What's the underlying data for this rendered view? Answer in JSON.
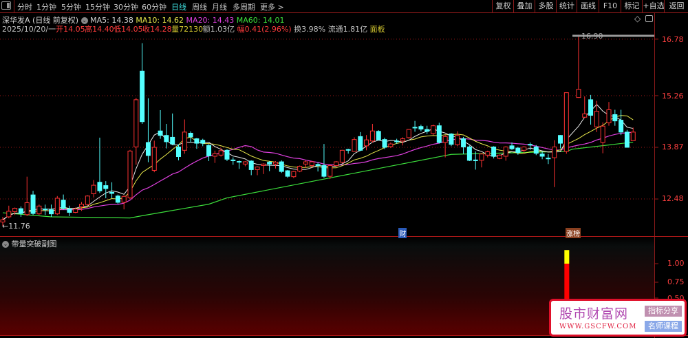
{
  "toolbar": {
    "tabs": [
      "分时",
      "1分钟",
      "5分钟",
      "15分钟",
      "30分钟",
      "60分钟",
      "日线",
      "周线",
      "月线",
      "多周期",
      "更多 >"
    ],
    "active_tab": "日线",
    "right_buttons": [
      "复权",
      "叠加",
      "多股",
      "统计",
      "画线",
      "F10",
      "标记",
      "+自选",
      "返回"
    ]
  },
  "info": {
    "title": "深华发A (日线 前复权)",
    "ma5": "MA5: 14.38",
    "ma10": "MA10: 14.62",
    "ma20": "MA20: 14.43",
    "ma60": "MA60: 14.01",
    "date": "2025/10/20/一",
    "open": "开14.05",
    "high": "高14.40",
    "low": "低14.05",
    "close": "收14.28",
    "volume": "量72130",
    "amount": "额1.03亿",
    "change": "幅0.41(2.96%)",
    "turnover": "换3.98%",
    "float": "流通1.81亿",
    "panel": "面板"
  },
  "axis": {
    "price_ticks": [
      "16.78",
      "15.26",
      "13.87",
      "12.48"
    ],
    "sub_ticks": [
      "1.00",
      "0.75",
      "0.50"
    ]
  },
  "markers": {
    "high": "16.90",
    "low": "←11.76"
  },
  "events": [
    {
      "label": "财",
      "index": 66,
      "color": "#3a7ad8"
    },
    {
      "label": "涨榜",
      "index": 94,
      "color": "#a05020"
    }
  ],
  "sub_chart": {
    "title": "带量突破副图"
  },
  "watermark": {
    "title": "股市财富网",
    "url": "WWW.GSCFW.COM",
    "tag1": "指标分享",
    "tag2": "名师课程"
  },
  "colors": {
    "up": "#ff3232",
    "down": "#54ffff",
    "ma5": "#e8e8e8",
    "ma10": "#e8e84a",
    "ma20": "#e040e0",
    "ma60": "#3ce03c",
    "grid": "#a01818"
  },
  "chart_data": {
    "type": "candlestick",
    "price_ticks": [
      16.78,
      15.26,
      13.87,
      12.48
    ],
    "candles_ohlc": [
      [
        11.86,
        12.0,
        11.76,
        11.92
      ],
      [
        12.0,
        12.3,
        11.96,
        12.15
      ],
      [
        12.14,
        12.25,
        12.05,
        12.23
      ],
      [
        12.22,
        12.28,
        12.0,
        12.09
      ],
      [
        12.06,
        13.08,
        12.02,
        12.38
      ],
      [
        12.59,
        12.7,
        12.05,
        12.09
      ],
      [
        12.08,
        12.33,
        12.05,
        12.29
      ],
      [
        12.21,
        12.33,
        12.05,
        12.19
      ],
      [
        12.19,
        12.33,
        12.0,
        12.08
      ],
      [
        12.08,
        12.56,
        12.05,
        12.5
      ],
      [
        12.45,
        12.6,
        12.19,
        12.23
      ],
      [
        12.21,
        12.3,
        12.02,
        12.12
      ],
      [
        12.12,
        12.25,
        12.1,
        12.21
      ],
      [
        12.27,
        12.4,
        12.16,
        12.34
      ],
      [
        12.33,
        12.58,
        12.3,
        12.56
      ],
      [
        12.62,
        12.99,
        12.52,
        12.85
      ],
      [
        12.93,
        14.13,
        12.64,
        12.7
      ],
      [
        12.84,
        12.96,
        12.5,
        12.76
      ],
      [
        12.66,
        12.93,
        12.5,
        12.63
      ],
      [
        12.56,
        12.6,
        12.35,
        12.39
      ],
      [
        12.39,
        12.58,
        12.2,
        12.55
      ],
      [
        12.51,
        13.8,
        12.48,
        13.77
      ],
      [
        13.88,
        15.2,
        13.4,
        15.15
      ],
      [
        15.92,
        16.67,
        14.5,
        14.56
      ],
      [
        14.0,
        15.19,
        13.47,
        13.65
      ],
      [
        13.25,
        14.05,
        13.2,
        13.87
      ],
      [
        14.31,
        14.87,
        14.1,
        14.19
      ],
      [
        14.19,
        14.5,
        13.84,
        14.02
      ],
      [
        14.14,
        14.78,
        13.93,
        13.96
      ],
      [
        13.88,
        13.95,
        13.52,
        13.62
      ],
      [
        13.79,
        14.62,
        13.7,
        14.28
      ],
      [
        14.25,
        14.3,
        14.0,
        14.15
      ],
      [
        14.1,
        14.12,
        13.83,
        13.98
      ],
      [
        14.06,
        14.1,
        13.9,
        13.98
      ],
      [
        13.92,
        13.95,
        13.5,
        13.64
      ],
      [
        13.63,
        13.78,
        13.45,
        13.7
      ],
      [
        13.66,
        13.85,
        13.62,
        13.78
      ],
      [
        13.79,
        13.82,
        13.5,
        13.55
      ],
      [
        13.53,
        13.6,
        13.4,
        13.51
      ],
      [
        13.49,
        13.52,
        13.29,
        13.47
      ],
      [
        13.42,
        13.5,
        13.36,
        13.48
      ],
      [
        13.5,
        13.52,
        13.12,
        13.27
      ],
      [
        13.27,
        13.36,
        13.12,
        13.34
      ],
      [
        13.38,
        13.44,
        13.15,
        13.42
      ],
      [
        13.47,
        13.5,
        13.23,
        13.42
      ],
      [
        13.42,
        13.5,
        13.3,
        13.47
      ],
      [
        13.48,
        13.52,
        13.18,
        13.22
      ],
      [
        13.24,
        13.26,
        13.05,
        13.09
      ],
      [
        13.08,
        13.24,
        13.04,
        13.22
      ],
      [
        13.23,
        13.38,
        13.2,
        13.36
      ],
      [
        13.42,
        13.52,
        13.32,
        13.48
      ],
      [
        13.38,
        13.5,
        13.32,
        13.48
      ],
      [
        13.41,
        13.46,
        13.22,
        13.38
      ],
      [
        13.38,
        13.96,
        13.05,
        13.09
      ],
      [
        13.09,
        13.4,
        13.02,
        13.38
      ],
      [
        13.38,
        13.5,
        13.35,
        13.48
      ],
      [
        13.47,
        13.8,
        13.44,
        13.79
      ],
      [
        13.81,
        13.83,
        13.7,
        13.79
      ],
      [
        13.76,
        14.14,
        13.75,
        14.08
      ],
      [
        14.16,
        14.28,
        13.77,
        13.79
      ],
      [
        13.91,
        14.2,
        13.79,
        14.07
      ],
      [
        14.04,
        14.5,
        14.0,
        14.31
      ],
      [
        14.3,
        14.33,
        14.05,
        14.07
      ],
      [
        14.08,
        14.13,
        13.82,
        13.87
      ],
      [
        13.89,
        14.0,
        13.85,
        13.96
      ],
      [
        14.04,
        14.1,
        13.97,
        14.02
      ],
      [
        14.04,
        14.14,
        13.92,
        14.1
      ],
      [
        14.13,
        14.36,
        14.1,
        14.35
      ],
      [
        14.41,
        14.58,
        14.29,
        14.39
      ],
      [
        14.43,
        14.48,
        14.3,
        14.36
      ],
      [
        14.35,
        14.45,
        14.23,
        14.3
      ],
      [
        14.24,
        14.48,
        14.2,
        14.45
      ],
      [
        14.45,
        14.53,
        13.97,
        14.0
      ],
      [
        14.0,
        14.2,
        13.6,
        14.16
      ],
      [
        14.23,
        14.25,
        13.9,
        13.95
      ],
      [
        13.94,
        14.3,
        13.9,
        14.19
      ],
      [
        14.1,
        14.15,
        13.69,
        13.88
      ],
      [
        13.88,
        13.92,
        13.5,
        13.52
      ],
      [
        13.53,
        13.76,
        13.27,
        13.51
      ],
      [
        13.52,
        13.72,
        13.33,
        13.69
      ],
      [
        13.66,
        13.78,
        13.6,
        13.75
      ],
      [
        13.88,
        13.9,
        13.57,
        13.63
      ],
      [
        13.57,
        13.68,
        13.55,
        13.66
      ],
      [
        13.63,
        13.9,
        13.51,
        13.88
      ],
      [
        13.91,
        14.0,
        13.8,
        13.83
      ],
      [
        13.85,
        13.88,
        13.67,
        13.73
      ],
      [
        13.79,
        13.9,
        13.7,
        13.88
      ],
      [
        13.95,
        14.0,
        13.8,
        13.93
      ],
      [
        13.88,
        13.93,
        13.66,
        13.71
      ],
      [
        13.69,
        13.76,
        13.55,
        13.63
      ],
      [
        13.58,
        13.69,
        13.42,
        13.56
      ],
      [
        13.59,
        14.06,
        12.8,
        13.88
      ],
      [
        14.19,
        14.2,
        13.84,
        13.98
      ],
      [
        13.76,
        15.34,
        13.7,
        15.34
      ],
      null,
      [
        15.21,
        16.9,
        15.2,
        15.43
      ],
      [
        14.68,
        15.24,
        14.66,
        14.77
      ],
      [
        15.15,
        15.28,
        14.48,
        14.73
      ],
      [
        14.42,
        15.12,
        14.28,
        14.84
      ],
      [
        14.0,
        14.54,
        13.71,
        14.44
      ],
      [
        14.53,
        15.09,
        14.45,
        14.88
      ],
      [
        14.75,
        14.88,
        14.45,
        14.58
      ],
      [
        14.6,
        14.88,
        14.2,
        14.28
      ],
      [
        14.28,
        14.34,
        13.87,
        13.87
      ],
      [
        14.05,
        14.4,
        14.05,
        14.28
      ]
    ],
    "ma60_points": [
      [
        0,
        12.11
      ],
      [
        8,
        12.0
      ],
      [
        21,
        11.97
      ],
      [
        23,
        12.03
      ],
      [
        34,
        12.34
      ],
      [
        37,
        12.51
      ],
      [
        74,
        13.68
      ],
      [
        93,
        13.76
      ],
      [
        94,
        13.82
      ],
      [
        104,
        14.01
      ]
    ],
    "indicator": {
      "index": 93,
      "red_value": 1.0,
      "yellow_value": 1.19,
      "ylim": [
        0.5,
        1.0
      ]
    }
  }
}
